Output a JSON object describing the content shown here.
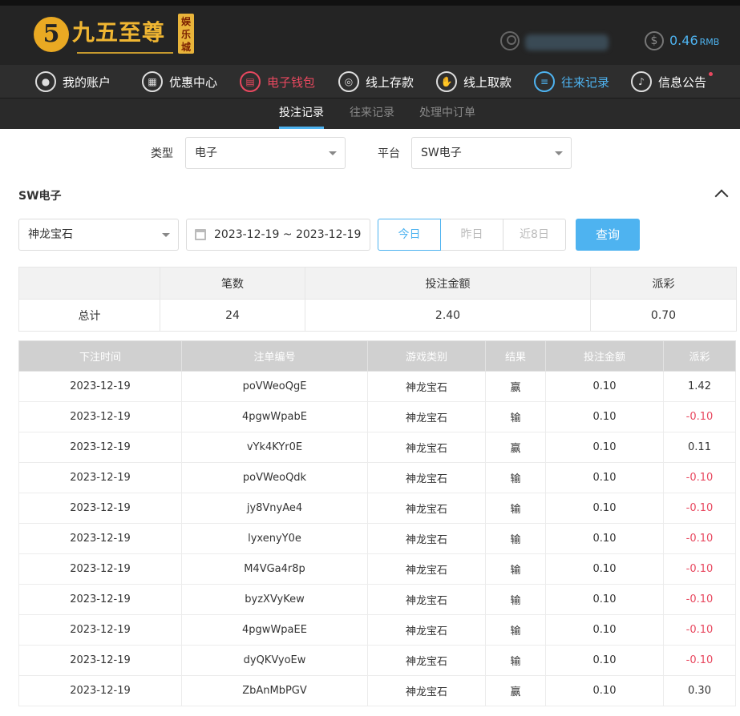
{
  "brand": {
    "logo_glyph": "5",
    "name": "九五至尊",
    "badge": "娱乐城"
  },
  "account": {
    "balance": "0.46",
    "currency": "RMB"
  },
  "nav": [
    {
      "label": "我的账户",
      "icon": "user-icon"
    },
    {
      "label": "优惠中心",
      "icon": "gift-icon"
    },
    {
      "label": "电子钱包",
      "icon": "wallet-icon"
    },
    {
      "label": "线上存款",
      "icon": "deposit-icon"
    },
    {
      "label": "线上取款",
      "icon": "withdraw-icon"
    },
    {
      "label": "往来记录",
      "icon": "records-icon"
    },
    {
      "label": "信息公告",
      "icon": "bell-icon"
    }
  ],
  "subtabs": [
    "投注记录",
    "往来记录",
    "处理中订单"
  ],
  "filters": {
    "type_label": "类型",
    "type_value": "电子",
    "platform_label": "平台",
    "platform_value": "SW电子"
  },
  "section": {
    "title": "SW电子"
  },
  "query": {
    "game_value": "神龙宝石",
    "date_range": "2023-12-19 ~ 2023-12-19",
    "quick": [
      "今日",
      "昨日",
      "近8日"
    ],
    "button": "查询"
  },
  "summary": {
    "headers": [
      "",
      "笔数",
      "投注金额",
      "派彩"
    ],
    "row": [
      "总计",
      "24",
      "2.40",
      "0.70"
    ]
  },
  "records": {
    "headers": [
      "下注时间",
      "注单编号",
      "游戏类别",
      "结果",
      "投注金额",
      "派彩"
    ],
    "rows": [
      [
        "2023-12-19",
        "poVWeoQgE",
        "神龙宝石",
        "赢",
        "0.10",
        "1.42"
      ],
      [
        "2023-12-19",
        "4pgwWpabE",
        "神龙宝石",
        "输",
        "0.10",
        "-0.10"
      ],
      [
        "2023-12-19",
        "vYk4KYr0E",
        "神龙宝石",
        "赢",
        "0.10",
        "0.11"
      ],
      [
        "2023-12-19",
        "poVWeoQdk",
        "神龙宝石",
        "输",
        "0.10",
        "-0.10"
      ],
      [
        "2023-12-19",
        "jy8VnyAe4",
        "神龙宝石",
        "输",
        "0.10",
        "-0.10"
      ],
      [
        "2023-12-19",
        "lyxenyY0e",
        "神龙宝石",
        "输",
        "0.10",
        "-0.10"
      ],
      [
        "2023-12-19",
        "M4VGa4r8p",
        "神龙宝石",
        "输",
        "0.10",
        "-0.10"
      ],
      [
        "2023-12-19",
        "byzXVyKew",
        "神龙宝石",
        "输",
        "0.10",
        "-0.10"
      ],
      [
        "2023-12-19",
        "4pgwWpaEE",
        "神龙宝石",
        "输",
        "0.10",
        "-0.10"
      ],
      [
        "2023-12-19",
        "dyQKVyoEw",
        "神龙宝石",
        "输",
        "0.10",
        "-0.10"
      ],
      [
        "2023-12-19",
        "ZbAnMbPGV",
        "神龙宝石",
        "赢",
        "0.10",
        "0.30"
      ]
    ]
  },
  "colors": {
    "accent": "#4eb3f0",
    "negative": "#e8485f",
    "gold": "#f0b632"
  }
}
